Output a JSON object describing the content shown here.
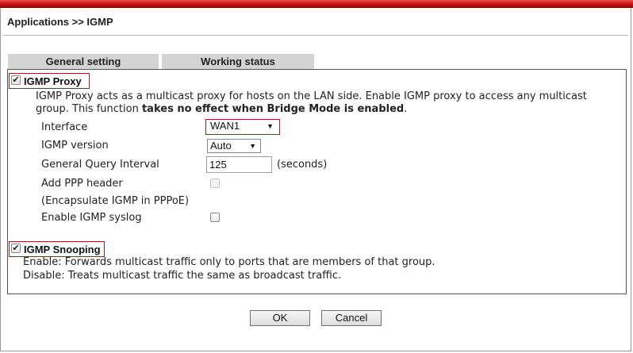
{
  "breadcrumb": "Applications >> IGMP",
  "tabs": [
    {
      "label": "General setting",
      "active": true
    },
    {
      "label": "Working status",
      "active": false
    }
  ],
  "igmp_proxy": {
    "label": "IGMP Proxy",
    "checked": true,
    "description_part1": "IGMP Proxy acts as a multicast proxy for hosts on the LAN side. Enable IGMP proxy to access any multicast",
    "description_part2": "group. This function ",
    "description_bold": "takes no effect when Bridge Mode is enabled",
    "description_end": ".",
    "interface_label": "Interface",
    "interface_value": "WAN1",
    "version_label": "IGMP version",
    "version_value": "Auto",
    "query_interval_label": "General Query Interval",
    "query_interval_value": "125",
    "query_interval_unit": "(seconds)",
    "ppp_header_label": "Add PPP header",
    "ppp_header_note": "(Encapsulate IGMP in PPPoE)",
    "syslog_label": "Enable IGMP syslog",
    "syslog_checked": false
  },
  "igmp_snooping": {
    "label": "IGMP Snooping",
    "checked": true,
    "enable_desc": "Enable: Forwards multicast traffic only to ports that are members of that group.",
    "disable_desc": "Disable: Treats multicast traffic the same as broadcast traffic."
  },
  "buttons": {
    "ok": "OK",
    "cancel": "Cancel"
  },
  "colors": {
    "highlight_border": "#a81e1e",
    "topbar": "#c81414",
    "tab_bg": "#d4d4d4"
  }
}
